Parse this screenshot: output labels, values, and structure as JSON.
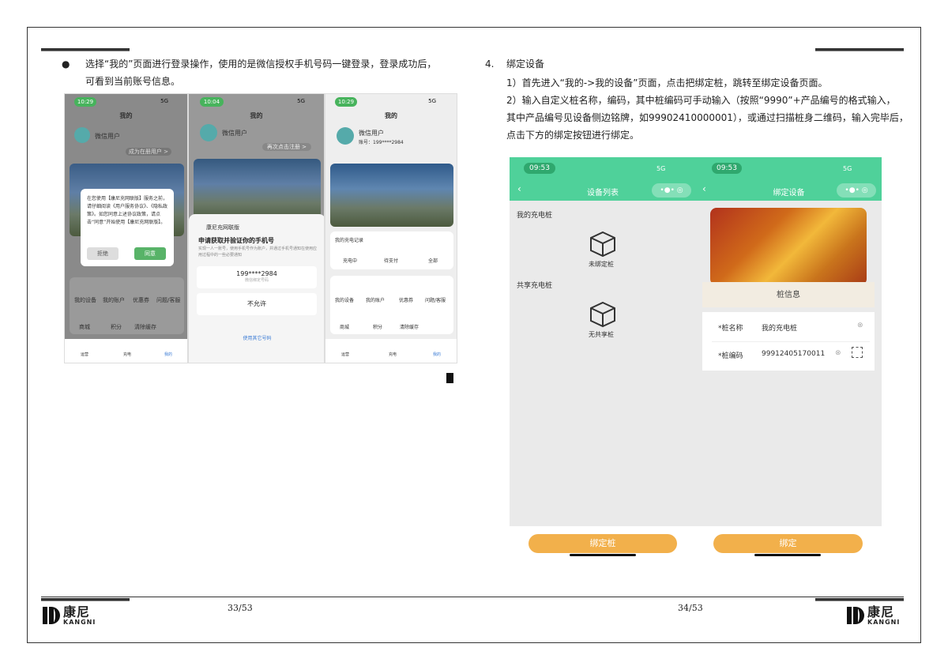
{
  "left": {
    "bullet": "●",
    "para_line1": "选择“我的”页面进行登录操作，使用的是微信授权手机号码一键登录，登录成功后，",
    "para_line2": "可看到当前账号信息。",
    "phone1": {
      "time": "10:29",
      "signal": "5G",
      "title": "我的",
      "user": "微信用户",
      "register": "成为在册用户 >",
      "dialog_text": "在您使用【康尼充网联版】服务之前，请仔细阅读《用户服务协议》、《隐私政策》。如您同意上述协议政策，请点击“同意”开始使用【康尼充网联版】。",
      "refuse": "拒绝",
      "agree": "同意",
      "grid": [
        "我的设备",
        "我的账户",
        "优惠券",
        "问题/客服",
        "商城",
        "积分",
        "清除缓存"
      ],
      "tabs": [
        "运营",
        "充电",
        "我的"
      ]
    },
    "phone2": {
      "time": "10:04",
      "signal": "5G",
      "title": "我的",
      "user": "微信用户",
      "register": "再次点击注册 >",
      "app": "康尼充网联版",
      "heading": "申请获取并验证你的手机号",
      "desc": "实现一人一账号，使用手机号作为账户，并通过手机号通知在使用应用过程中的一些必要通知",
      "phone": "199****2984",
      "phone_sub": "微信绑定号码",
      "deny": "不允许",
      "other": "使用其它号码"
    },
    "phone3": {
      "time": "10:29",
      "signal": "5G",
      "title": "我的",
      "user": "微信用户",
      "account": "账号：199****2984",
      "record": "我的充电记录",
      "states": [
        "充电中",
        "待支付",
        "全部"
      ],
      "grid": [
        "我的设备",
        "我的账户",
        "优惠券",
        "问题/客服",
        "商城",
        "积分",
        "清除缓存"
      ],
      "tabs": [
        "运营",
        "充电",
        "我的"
      ]
    },
    "page_no": "33/53"
  },
  "right": {
    "num": "4.",
    "title": "绑定设备",
    "step1": "1）首先进入“我的->我的设备”页面，点击把绑定桩，跳转至绑定设备页面。",
    "step2_l1": "2）输入自定义桩名称，编码，其中桩编码可手动输入（按照“9990”+产品编号的格式输入，",
    "step2_l2": "其中产品编号见设备侧边铭牌，如99902410000001），或通过扫描桩身二维码，输入完毕后，",
    "step2_l3": "点击下方的绑定按钮进行绑定。",
    "phone_a": {
      "time": "09:53",
      "signal": "5G",
      "title": "设备列表",
      "my_piles": "我的充电桩",
      "no_bound": "未绑定桩",
      "shared": "共享充电桩",
      "no_shared": "无共享桩",
      "button": "绑定桩"
    },
    "phone_b": {
      "time": "09:53",
      "signal": "5G",
      "title": "绑定设备",
      "info": "桩信息",
      "name_label": "*桩名称",
      "name_value": "我的充电桩",
      "code_label": "*桩编码",
      "code_value": "99912405170011",
      "button": "绑定"
    },
    "page_no": "34/53"
  },
  "brand": {
    "cn": "康尼",
    "en": "KANGNI"
  },
  "colors": {
    "accent": "#4fd19a",
    "orange": "#f2b04b",
    "wechat_green": "#58b368"
  }
}
